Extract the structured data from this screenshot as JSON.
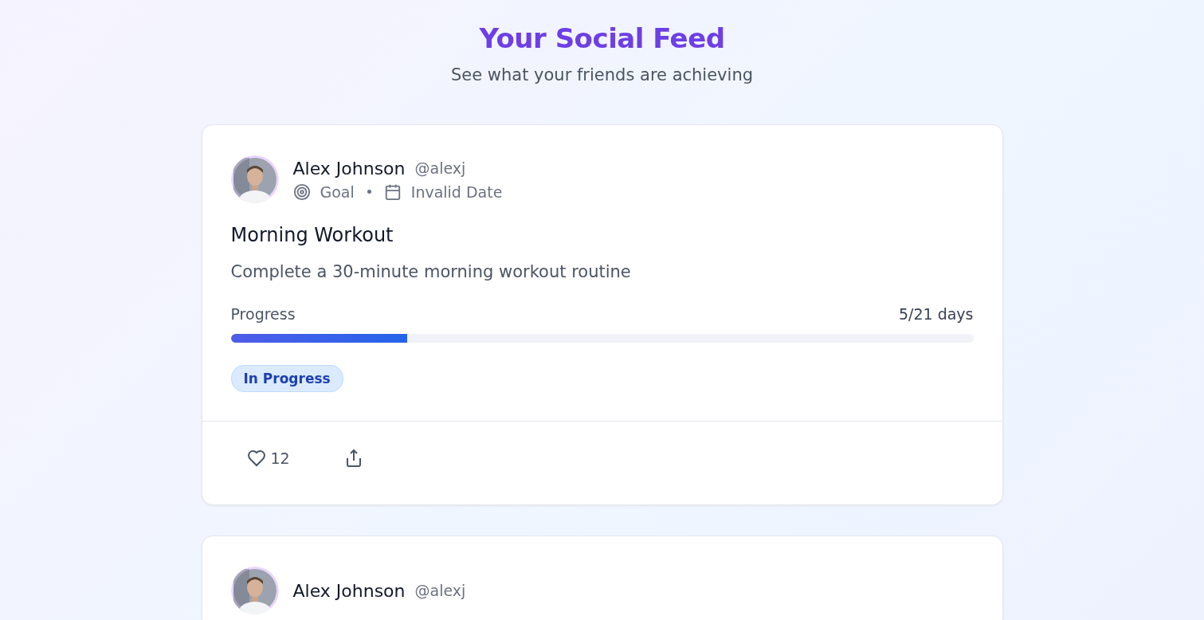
{
  "header": {
    "title": "Your Social Feed",
    "subtitle": "See what your friends are achieving"
  },
  "posts": [
    {
      "user": {
        "name": "Alex Johnson",
        "handle": "@alexj"
      },
      "type": "Goal",
      "date": "Invalid Date",
      "title": "Morning Workout",
      "description": "Complete a 30-minute morning workout routine",
      "progress": {
        "label": "Progress",
        "reading": "5/21 days",
        "level": 0.238
      },
      "status": "In Progress",
      "likes": "12",
      "liked": false
    },
    {
      "user": {
        "name": "Alex Johnson",
        "handle": "@alexj"
      }
    }
  ]
}
